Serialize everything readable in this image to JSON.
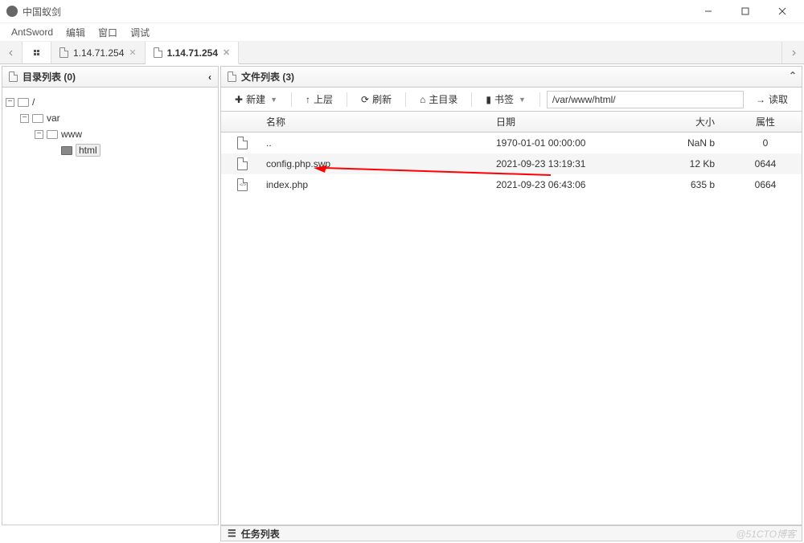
{
  "window": {
    "title": "中国蚁剑"
  },
  "menubar": {
    "items": [
      "AntSword",
      "编辑",
      "窗口",
      "调试"
    ]
  },
  "tabs": {
    "items": [
      {
        "label": "1.14.71.254",
        "active": false
      },
      {
        "label": "1.14.71.254",
        "active": true
      }
    ]
  },
  "dir_panel": {
    "title": "目录列表 (0)",
    "tree": {
      "root": "/",
      "l1": "var",
      "l2": "www",
      "l3": "html"
    }
  },
  "file_panel": {
    "title": "文件列表 (3)",
    "toolbar": {
      "new_label": "新建",
      "up_label": "上层",
      "refresh_label": "刷新",
      "home_label": "主目录",
      "bookmark_label": "书签",
      "path": "/var/www/html/",
      "read_label": "读取"
    },
    "columns": {
      "name": "名称",
      "date": "日期",
      "size": "大小",
      "attr": "属性"
    },
    "rows": [
      {
        "name": "..",
        "date": "1970-01-01 00:00:00",
        "size": "NaN b",
        "attr": "0",
        "kind": "file"
      },
      {
        "name": "config.php.swp",
        "date": "2021-09-23 13:19:31",
        "size": "12 Kb",
        "attr": "0644",
        "kind": "file",
        "highlighted": true
      },
      {
        "name": "index.php",
        "date": "2021-09-23 06:43:06",
        "size": "635 b",
        "attr": "0664",
        "kind": "code"
      }
    ]
  },
  "task_bar": {
    "title": "任务列表"
  },
  "watermark": "@51CTO博客"
}
